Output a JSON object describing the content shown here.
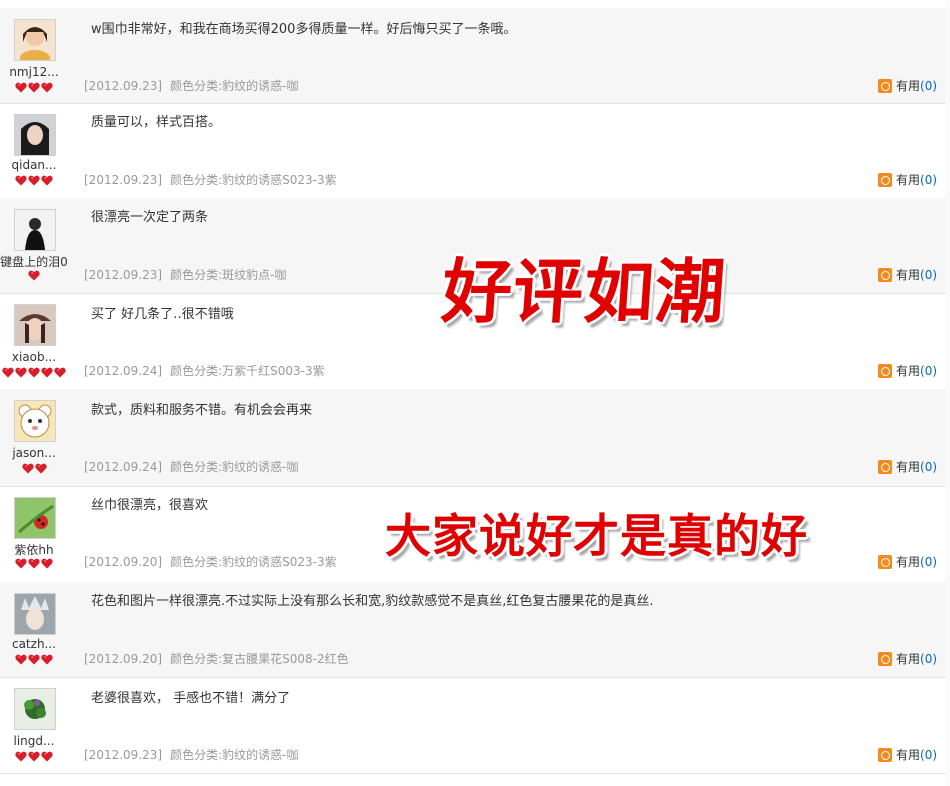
{
  "reviews": [
    {
      "username": "nmj12...",
      "hearts": 3,
      "content": "w围巾非常好，和我在商场买得200多得质量一样。好后悔只买了一条哦。",
      "date": "[2012.09.23]",
      "color_label": "颜色分类:豹纹的诱惑-咖",
      "useful_label": "有用",
      "useful_count": "(0)",
      "avatar_icon": "girl-with-bear-avatar"
    },
    {
      "username": "qidan...",
      "hearts": 3,
      "content": "质量可以，样式百搭。",
      "date": "[2012.09.23]",
      "color_label": "颜色分类:豹纹的诱惑S023-3紫",
      "useful_label": "有用",
      "useful_count": "(0)",
      "avatar_icon": "dark-hair-girl-avatar"
    },
    {
      "username": "键盘上的泪0",
      "hearts": 1,
      "content": "很漂亮一次定了两条",
      "date": "[2012.09.23]",
      "color_label": "颜色分类:斑纹豹点-咖",
      "useful_label": "有用",
      "useful_count": "(0)",
      "avatar_icon": "woman-in-black-avatar"
    },
    {
      "username": "xiaob...",
      "hearts": 5,
      "content": "买了 好几条了‥很不错哦",
      "date": "[2012.09.24]",
      "color_label": "颜色分类:万紫千红S003-3紫",
      "useful_label": "有用",
      "useful_count": "(0)",
      "avatar_icon": "girl-with-cap-avatar"
    },
    {
      "username": "jason...",
      "hearts": 2,
      "content": "款式，质料和服务不错。有机会会再来",
      "date": "[2012.09.24]",
      "color_label": "颜色分类:豹纹的诱惑-咖",
      "useful_label": "有用",
      "useful_count": "(0)",
      "avatar_icon": "cartoon-bear-avatar"
    },
    {
      "username": "紫依hh",
      "hearts": 3,
      "content": "丝巾很漂亮，很喜欢",
      "date": "[2012.09.20]",
      "color_label": "颜色分类:豹纹的诱惑S023-3紫",
      "useful_label": "有用",
      "useful_count": "(0)",
      "avatar_icon": "ladybug-avatar"
    },
    {
      "username": "catzh...",
      "hearts": 3,
      "content": "花色和图片一样很漂亮.不过实际上没有那么长和宽,豹纹款感觉不是真丝,红色复古腰果花的是真丝.",
      "date": "[2012.09.20]",
      "color_label": "颜色分类:复古腰果花S008-2红色",
      "useful_label": "有用",
      "useful_count": "(0)",
      "avatar_icon": "silver-headdress-avatar"
    },
    {
      "username": "lingd...",
      "hearts": 3,
      "content": "老婆很喜欢， 手感也不错！满分了",
      "date": "[2012.09.23]",
      "color_label": "颜色分类:豹纹的诱惑-咖",
      "useful_label": "有用",
      "useful_count": "(0)",
      "avatar_icon": "plant-photo-avatar"
    }
  ],
  "banners": {
    "top": "好评如潮",
    "bottom": "大家说好才是真的好"
  },
  "colors": {
    "banner_red": "#e10000",
    "heart_red": "#d81e2a",
    "useful_icon": "#f38a1f",
    "count_blue": "#0066cc",
    "meta_gray": "#999999"
  }
}
